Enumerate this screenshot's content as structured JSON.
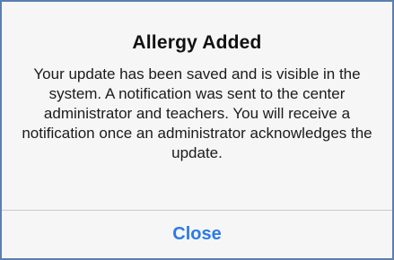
{
  "alert": {
    "title": "Allergy Added",
    "message": "Your update has been saved and is visible in the system. A notification was sent to the center administrator and teachers. You will receive a notification once an administrator acknowledges the update.",
    "close_label": "Close"
  },
  "colors": {
    "frame_border": "#5b7fae",
    "dialog_background": "#f6f6f6",
    "title_text": "#111111",
    "message_text": "#1b1b1b",
    "divider": "#c9c9cc",
    "action_text": "#2b7be5"
  }
}
